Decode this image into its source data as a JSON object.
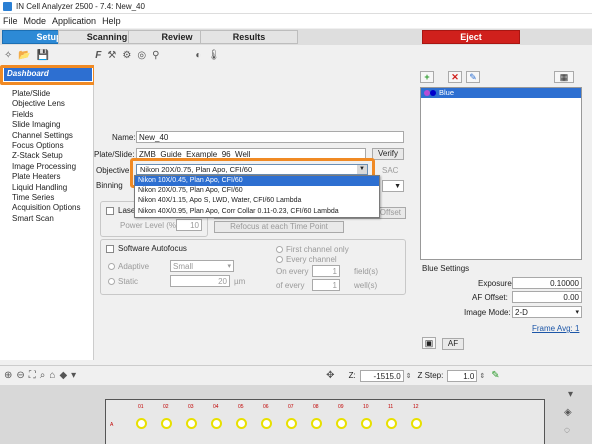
{
  "window": {
    "title": "IN Cell Analyzer 2500 - 7.4: New_40"
  },
  "menu": [
    "File",
    "Mode",
    "Application",
    "Help"
  ],
  "tabs": [
    {
      "label": "Setup",
      "active": true
    },
    {
      "label": "Scanning"
    },
    {
      "label": "Review"
    },
    {
      "label": "Results"
    },
    {
      "label": "Eject"
    }
  ],
  "left_nav": {
    "dashboard": "Dashboard",
    "items": [
      "Plate/Slide",
      "Objective Lens",
      "Fields",
      "Slide Imaging",
      "Channel Settings",
      "Focus Options",
      "Z-Stack Setup",
      "Image Processing",
      "Plate Heaters",
      "Liquid Handling",
      "Time Series",
      "Acquisition Options",
      "Smart Scan"
    ]
  },
  "form": {
    "name_label": "Name:",
    "name_value": "New_40",
    "plate_label": "Plate/Slide:",
    "plate_value": "ZMB_Guide_Example_96_Well",
    "verify_label": "Verify",
    "objective_label": "Objective",
    "objective_value": "Nikon 20X/0.75, Plan Apo, CFI/60",
    "binning_label": "Binning",
    "sac_label": "SAC",
    "objective_options": [
      "Nikon 10X/0.45, Plan Apo, CFI/60",
      "Nikon 20X/0.75, Plan Apo, CFI/60",
      "Nikon 40X/1.15, Apo S, LWD, Water, CFI/60 Lambda",
      "Nikon 40X/0.95, Plan Apo, Corr Collar 0.11-0.23, CFI/60 Lambda"
    ],
    "laser_label": "Laser",
    "power_label": "Power Level (%):",
    "power_value": "10",
    "offset_label": "to Offset",
    "refocus_label": "Refocus at each Time Point"
  },
  "autofocus": {
    "title": "Software Autofocus",
    "adaptive": "Adaptive",
    "adaptive_value": "Small",
    "static": "Static",
    "static_value": "20",
    "static_unit": "µm",
    "first_channel": "First channel only",
    "every_channel": "Every channel",
    "on_every": "On every",
    "on_every_value": "1",
    "fields_unit": "field(s)",
    "of_every": "of every",
    "of_every_value": "1",
    "wells_unit": "well(s)"
  },
  "channels": {
    "selected": "Blue",
    "settings_title": "Blue Settings",
    "exposure_label": "Exposure:",
    "exposure_value": "0.10000",
    "af_offset_label": "AF Offset:",
    "af_offset_value": "0.00",
    "image_mode_label": "Image Mode:",
    "image_mode_value": "2-D",
    "frame_avg": "Frame Avg: 1",
    "af_button": "AF"
  },
  "bottom_toolbar": {
    "z_label": "Z:",
    "z_value": "-1515.0",
    "zstep_label": "Z Step:",
    "zstep_value": "1.0"
  },
  "plate": {
    "columns": [
      "01",
      "02",
      "03",
      "04",
      "05",
      "06",
      "07",
      "08",
      "09",
      "10",
      "11",
      "12"
    ],
    "row_label": "A"
  }
}
